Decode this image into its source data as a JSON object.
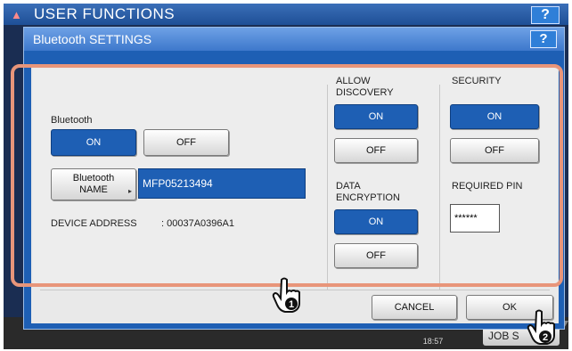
{
  "background": {
    "title": "USER FUNCTIONS",
    "help_label": "?",
    "datetime": "18:57",
    "job_button_label": "JOB S"
  },
  "dialog": {
    "title": "Bluetooth SETTINGS",
    "help_label": "?"
  },
  "bluetooth": {
    "label": "Bluetooth",
    "on_label": "ON",
    "off_label": "OFF",
    "selected": "ON",
    "name_button_line1": "Bluetooth",
    "name_button_line2": "NAME",
    "name_value": "MFP05213494",
    "device_address_label": "DEVICE ADDRESS",
    "device_address_value": ": 00037A0396A1"
  },
  "allow_discovery": {
    "label": "ALLOW DISCOVERY",
    "on_label": "ON",
    "off_label": "OFF",
    "selected": "ON"
  },
  "data_encryption": {
    "label": "DATA ENCRYPTION",
    "on_label": "ON",
    "off_label": "OFF",
    "selected": "ON"
  },
  "security": {
    "label": "SECURITY",
    "on_label": "ON",
    "off_label": "OFF",
    "selected": "ON",
    "required_pin_label": "REQUIRED PIN",
    "required_pin_value": "******"
  },
  "footer": {
    "cancel_label": "CANCEL",
    "ok_label": "OK"
  },
  "annotations": {
    "step1": "1",
    "step2": "2"
  },
  "colors": {
    "selected": "#1e5fb4",
    "highlight_frame": "#e8957a"
  }
}
